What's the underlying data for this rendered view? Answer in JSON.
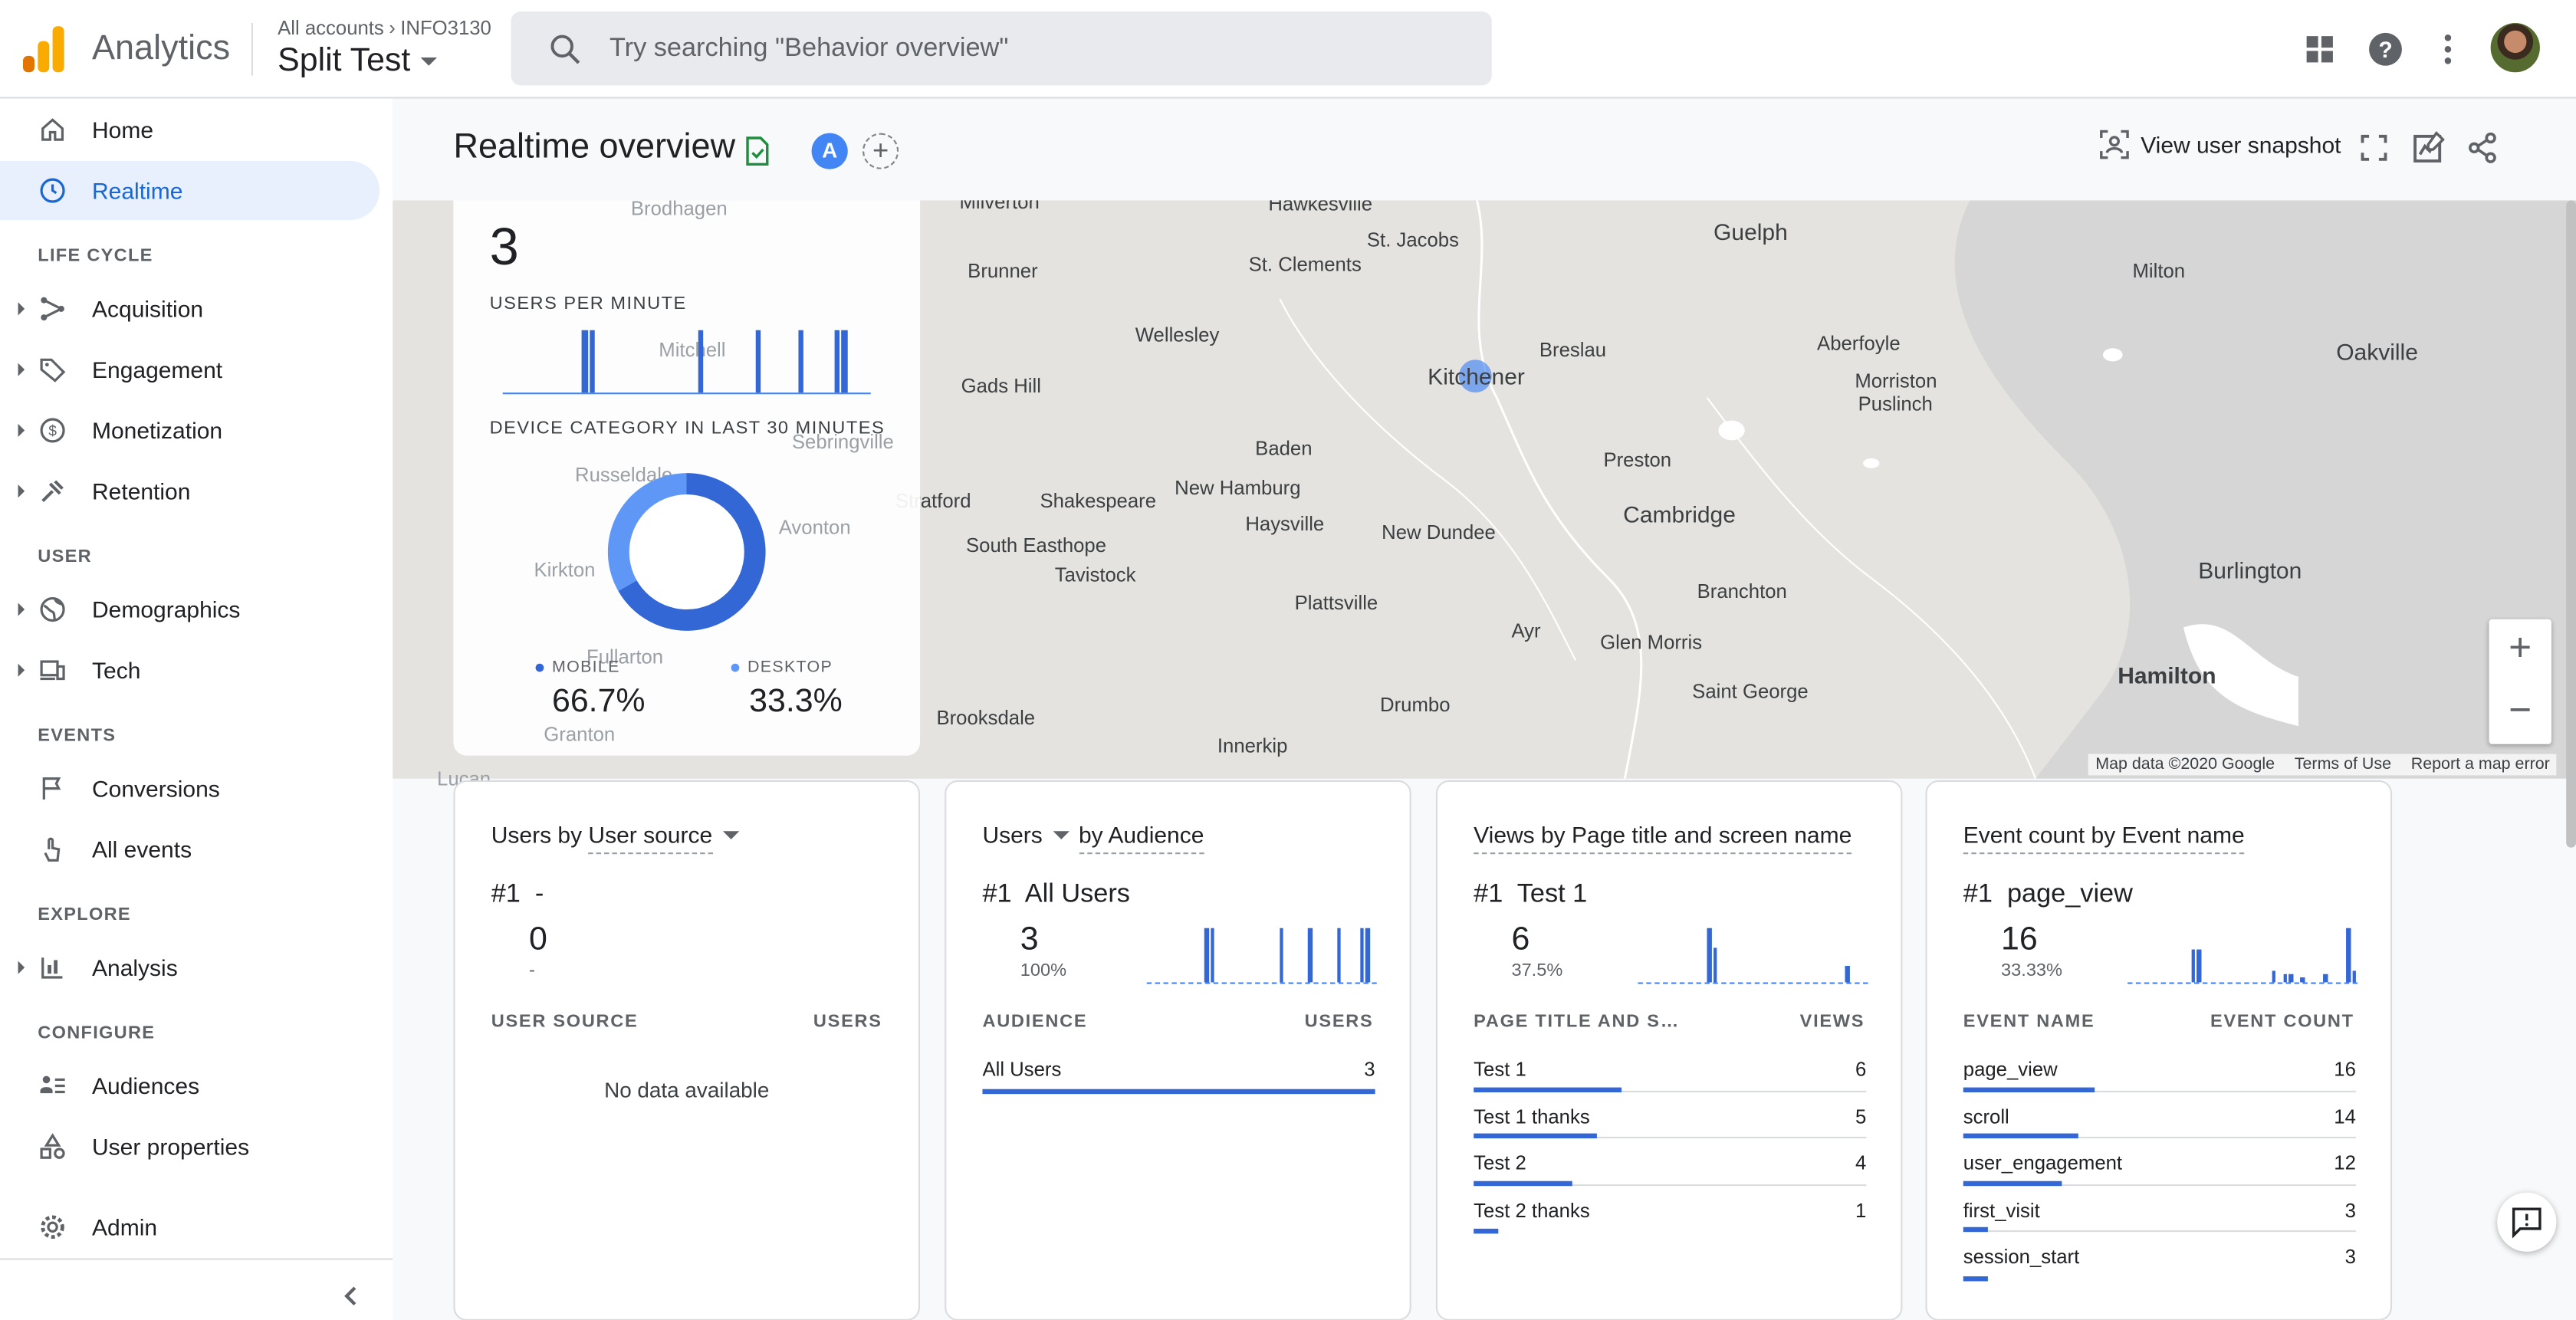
{
  "app": {
    "name": "Analytics"
  },
  "account": {
    "breadcrumb_root": "All accounts",
    "breadcrumb_account": "INFO3130",
    "property": "Split Test"
  },
  "search": {
    "placeholder": "Try searching \"Behavior overview\""
  },
  "sidebar": {
    "items": [
      {
        "label": "Home",
        "icon": "home-icon"
      },
      {
        "label": "Realtime",
        "icon": "clock-icon",
        "active": true
      },
      {
        "label": "Acquisition",
        "icon": "acquisition-icon"
      },
      {
        "label": "Engagement",
        "icon": "tag-icon"
      },
      {
        "label": "Monetization",
        "icon": "dollar-icon"
      },
      {
        "label": "Retention",
        "icon": "retention-icon"
      },
      {
        "label": "Demographics",
        "icon": "globe-icon"
      },
      {
        "label": "Tech",
        "icon": "devices-icon"
      },
      {
        "label": "Conversions",
        "icon": "flag-icon"
      },
      {
        "label": "All events",
        "icon": "touch-icon"
      },
      {
        "label": "Analysis",
        "icon": "analysis-icon"
      },
      {
        "label": "Audiences",
        "icon": "audiences-icon"
      },
      {
        "label": "User properties",
        "icon": "shapes-icon"
      },
      {
        "label": "Admin",
        "icon": "gear-icon"
      }
    ],
    "sections": {
      "lifecycle": "LIFE CYCLE",
      "user": "USER",
      "events": "EVENTS",
      "explore": "EXPLORE",
      "configure": "CONFIGURE"
    }
  },
  "header": {
    "title": "Realtime overview",
    "segment_badge": "A",
    "add_segment": "+",
    "snapshot_label": "View user snapshot"
  },
  "overview": {
    "users_count": "3",
    "users_per_minute_label": "USERS PER MINUTE",
    "device_label": "DEVICE CATEGORY IN LAST 30 MINUTES",
    "mobile_label": "MOBILE",
    "mobile_value": "66.7%",
    "desktop_label": "DESKTOP",
    "desktop_value": "33.3%"
  },
  "map": {
    "labels": [
      "Milverton",
      "Hawkesville",
      "St. Jacobs",
      "Guelph",
      "Brunner",
      "St. Clements",
      "Milton",
      "Wellesley",
      "Breslau",
      "Aberfoyle",
      "Oakville",
      "Gads Hill",
      "Kitchener",
      "Morriston",
      "Puslinch",
      "Baden",
      "Preston",
      "Stratford",
      "Shakespeare",
      "New Hamburg",
      "Cambridge",
      "Haysville",
      "New Dundee",
      "South Easthope",
      "Tavistock",
      "Branchton",
      "Burlington",
      "Plattsville",
      "Ayr",
      "Glen Morris",
      "Hamilton",
      "Saint George",
      "Drumbo",
      "Brooksdale",
      "Innerkip",
      "Brodhagen",
      "Mitchell",
      "Sebringville",
      "Russeldale",
      "Avonton",
      "Kirkton",
      "Fullarton",
      "Granton",
      "Lucan"
    ],
    "zoom_in": "+",
    "zoom_out": "−",
    "attribution": {
      "data": "Map data ©2020 Google",
      "terms": "Terms of Use",
      "report": "Report a map error"
    }
  },
  "cards": {
    "source": {
      "title_prefix": "Users by",
      "title_dim": "User source",
      "top_rank": "#1",
      "top_name": "-",
      "top_value": "0",
      "top_pct": "-",
      "col1": "USER SOURCE",
      "col2": "USERS",
      "empty": "No data available"
    },
    "audience": {
      "title_metric": "Users",
      "title_dim": "by Audience",
      "top_rank": "#1",
      "top_name": "All Users",
      "top_value": "3",
      "top_pct": "100%",
      "col1": "AUDIENCE",
      "col2": "USERS",
      "rows": [
        {
          "label": "All Users",
          "value": "3",
          "share": 1.0
        }
      ]
    },
    "pages": {
      "title": "Views by Page title and screen name",
      "top_rank": "#1",
      "top_name": "Test 1",
      "top_value": "6",
      "top_pct": "37.5%",
      "col1": "PAGE TITLE AND S…",
      "col2": "VIEWS",
      "rows": [
        {
          "label": "Test 1",
          "value": "6",
          "share": 1.0
        },
        {
          "label": "Test 1 thanks",
          "value": "5",
          "share": 0.83
        },
        {
          "label": "Test 2",
          "value": "4",
          "share": 0.67
        },
        {
          "label": "Test 2 thanks",
          "value": "1",
          "share": 0.17
        }
      ]
    },
    "events": {
      "title": "Event count by Event name",
      "top_rank": "#1",
      "top_name": "page_view",
      "top_value": "16",
      "top_pct": "33.33%",
      "col1": "EVENT NAME",
      "col2": "EVENT COUNT",
      "rows": [
        {
          "label": "page_view",
          "value": "16",
          "share": 1.0
        },
        {
          "label": "scroll",
          "value": "14",
          "share": 0.875
        },
        {
          "label": "user_engagement",
          "value": "12",
          "share": 0.75
        },
        {
          "label": "first_visit",
          "value": "3",
          "share": 0.19
        },
        {
          "label": "session_start",
          "value": "3",
          "share": 0.19
        }
      ]
    }
  },
  "colors": {
    "accent": "#1a73e8",
    "bar": "#3367d6",
    "logo_orange": "#f9ab00",
    "logo_dark": "#e37400"
  }
}
